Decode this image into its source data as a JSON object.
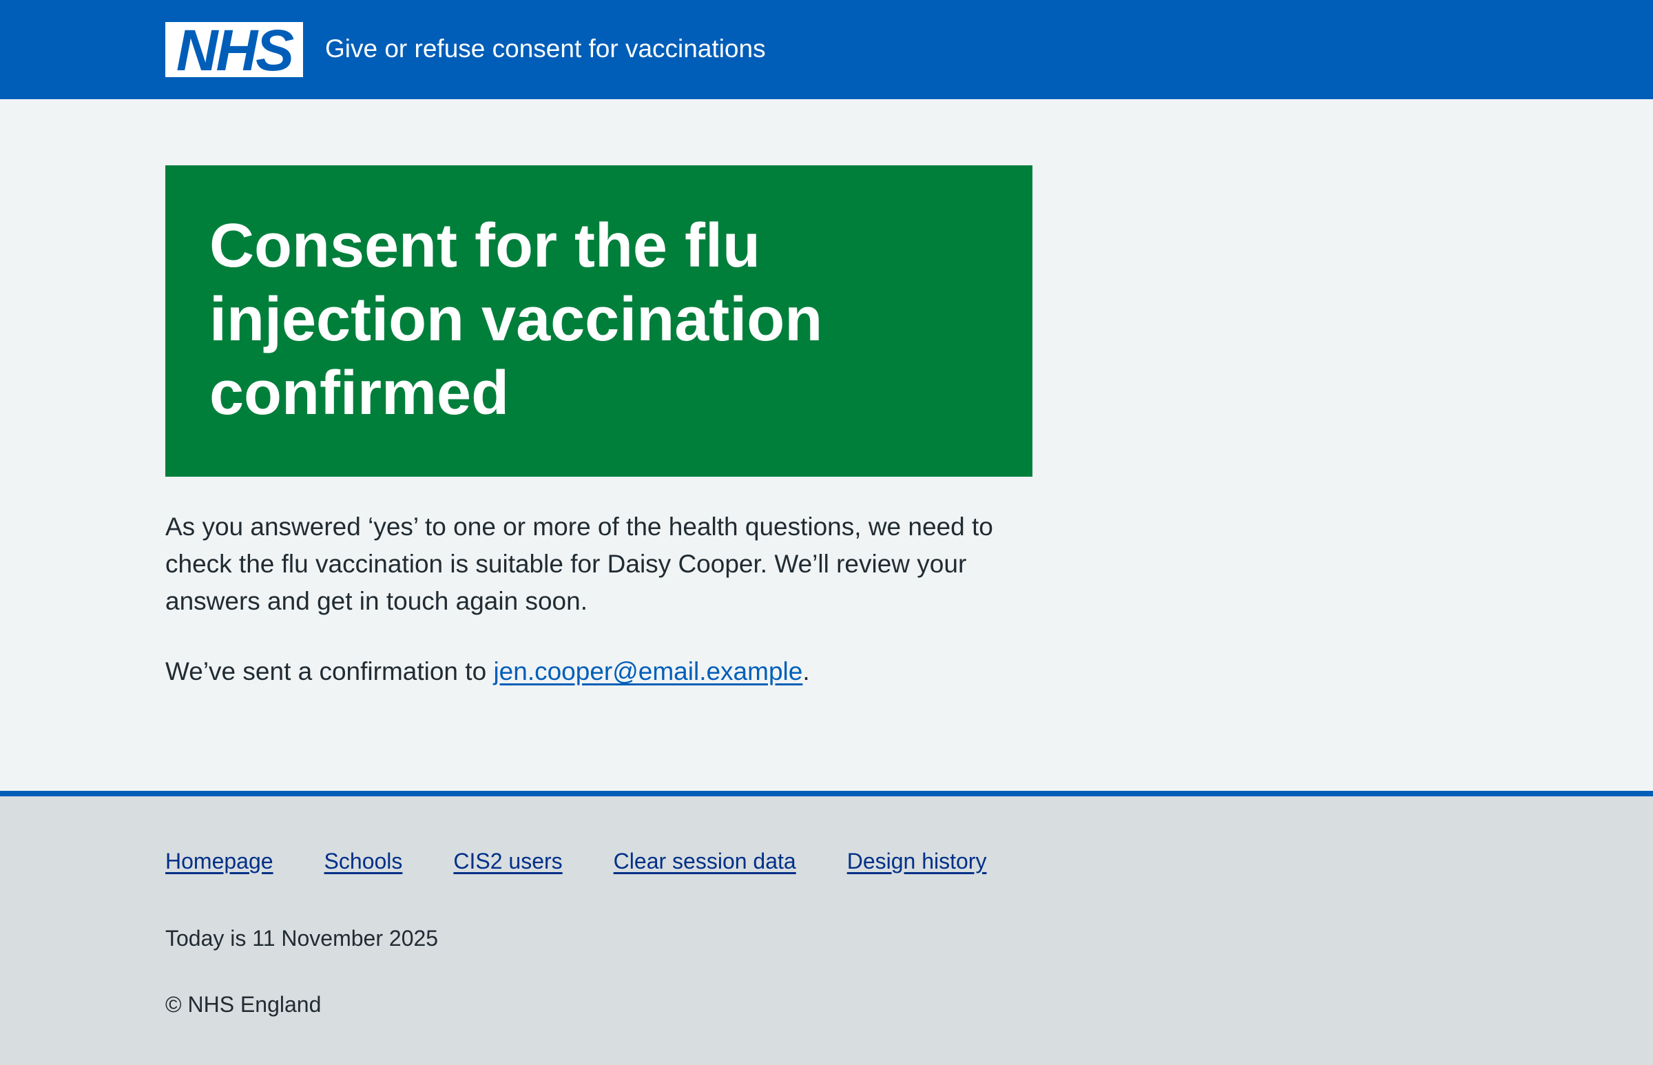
{
  "header": {
    "logo_text": "NHS",
    "service_name": "Give or refuse consent for vaccinations"
  },
  "panel": {
    "title": "Consent for the flu injection vaccination confirmed"
  },
  "main": {
    "paragraph_1": "As you answered ‘yes’ to one or more of the health questions, we need to check the flu vaccination is suitable for Daisy Cooper. We’ll review your answers and get in touch again soon.",
    "confirmation_prefix": "We’ve sent a confirmation to ",
    "email": "jen.cooper@email.example",
    "confirmation_suffix": "."
  },
  "footer": {
    "links": [
      "Homepage",
      "Schools",
      "CIS2 users",
      "Clear session data",
      "Design history"
    ],
    "today": "Today is 11 November 2025",
    "copyright": "© NHS England"
  },
  "colors": {
    "header_blue": "#005eb8",
    "panel_green": "#007f3b",
    "page_background": "#f0f4f5",
    "footer_background": "#d8dde0",
    "link_blue": "#005eb8",
    "footer_link": "#003087",
    "text": "#212b32"
  }
}
